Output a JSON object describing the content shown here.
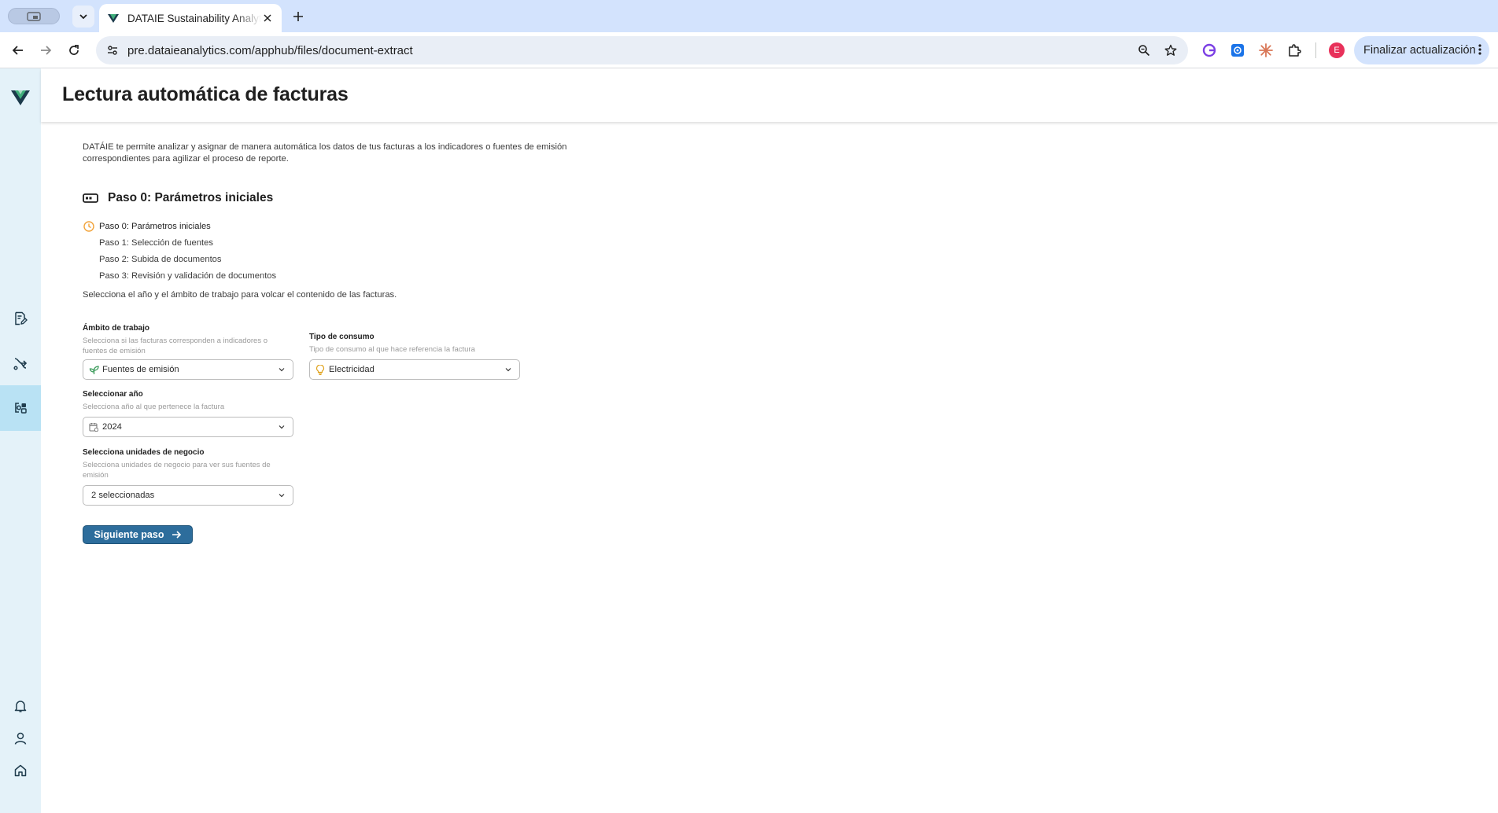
{
  "browser": {
    "tab_title": "DATAIE Sustainability Analytics",
    "url": "pre.dataieanalytics.com/apphub/files/document-extract",
    "avatar_initial": "E",
    "update_button_label": "Finalizar actualización"
  },
  "page": {
    "title": "Lectura automática de facturas",
    "intro": "DATÁIE te permite analizar y asignar de manera automática los datos de tus facturas a los indicadores o fuentes de emisión correspondientes para agilizar el proceso de reporte.",
    "step_heading": "Paso 0: Parámetros iniciales",
    "steps": [
      {
        "label": "Paso 0: Parámetros iniciales",
        "status": "current"
      },
      {
        "label": "Paso 1: Selección de fuentes",
        "status": "pending"
      },
      {
        "label": "Paso 2: Subida de documentos",
        "status": "pending"
      },
      {
        "label": "Paso 3: Revisión y validación de documentos",
        "status": "pending"
      }
    ],
    "select_hint": "Selecciona el año y el ámbito de trabajo para volcar el contenido de las facturas."
  },
  "form": {
    "scope": {
      "label": "Ámbito de trabajo",
      "help": "Selecciona si las facturas corresponden a indicadores o fuentes de emisión",
      "value": "Fuentes de emisión",
      "icon": "leaf-icon"
    },
    "consumption": {
      "label": "Tipo de consumo",
      "help": "Tipo de consumo al que hace referencia la factura",
      "value": "Electricidad",
      "icon": "lightbulb-icon"
    },
    "year": {
      "label": "Seleccionar año",
      "help": "Selecciona año al que pertenece la factura",
      "value": "2024",
      "icon": "calendar-icon"
    },
    "business_units": {
      "label": "Selecciona unidades de negocio",
      "help": "Selecciona unidades de negocio para ver sus fuentes de emisión",
      "value": "2 seleccionadas"
    },
    "next_button": "Siguiente paso"
  },
  "colors": {
    "primary": "#2d6d9c",
    "sidebar_bg": "#e4f2f9",
    "sidebar_active": "#b9e2f4",
    "step_current": "#f2a33a"
  }
}
